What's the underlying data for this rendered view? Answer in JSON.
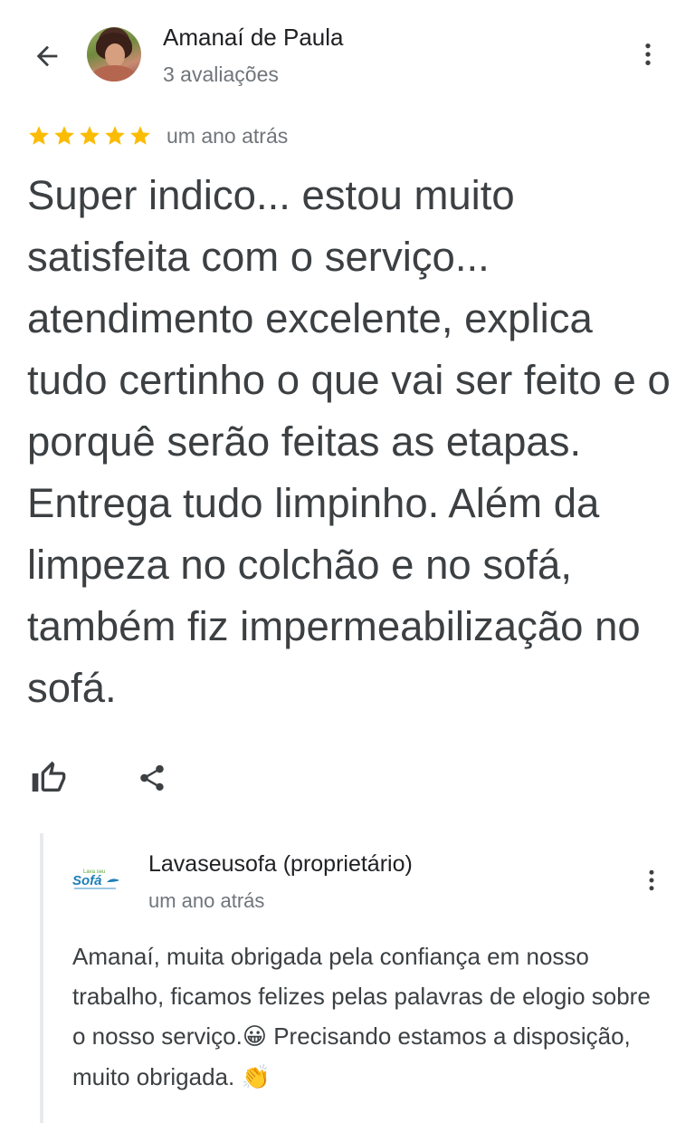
{
  "reviewer": {
    "name": "Amanaí de Paula",
    "reviews_count": "3 avaliações"
  },
  "review": {
    "rating": 5,
    "max_rating": 5,
    "star_color": "#fbbc04",
    "date": "um ano atrás",
    "text": "Super indico... estou muito satisfeita com o serviço... atendimento excelente, explica tudo certinho o que vai ser feito e o porquê serão feitas as etapas. Entrega tudo limpinho. Além da limpeza no colchão e no sofá, também fiz impermeabilização no sofá."
  },
  "icons": {
    "back": "arrow-left-icon",
    "more": "more-vert-icon",
    "like": "thumb-up-icon",
    "share": "share-icon"
  },
  "owner_reply": {
    "owner_name": "Lavaseusofa (proprietário)",
    "date": "um ano atrás",
    "logo_text": "Sofá",
    "logo_top_text": "Lava seu",
    "brand_color": "#1e7fb8",
    "text_part1": "Amanaí, muita obrigada pela confiança em nosso trabalho, ficamos felizes pelas palavras de elogio sobre o nosso serviço.",
    "emoji_grin": "😀",
    "text_part2": " Precisando estamos a disposição, muito obrigada. ",
    "emoji_clap": "👏"
  }
}
